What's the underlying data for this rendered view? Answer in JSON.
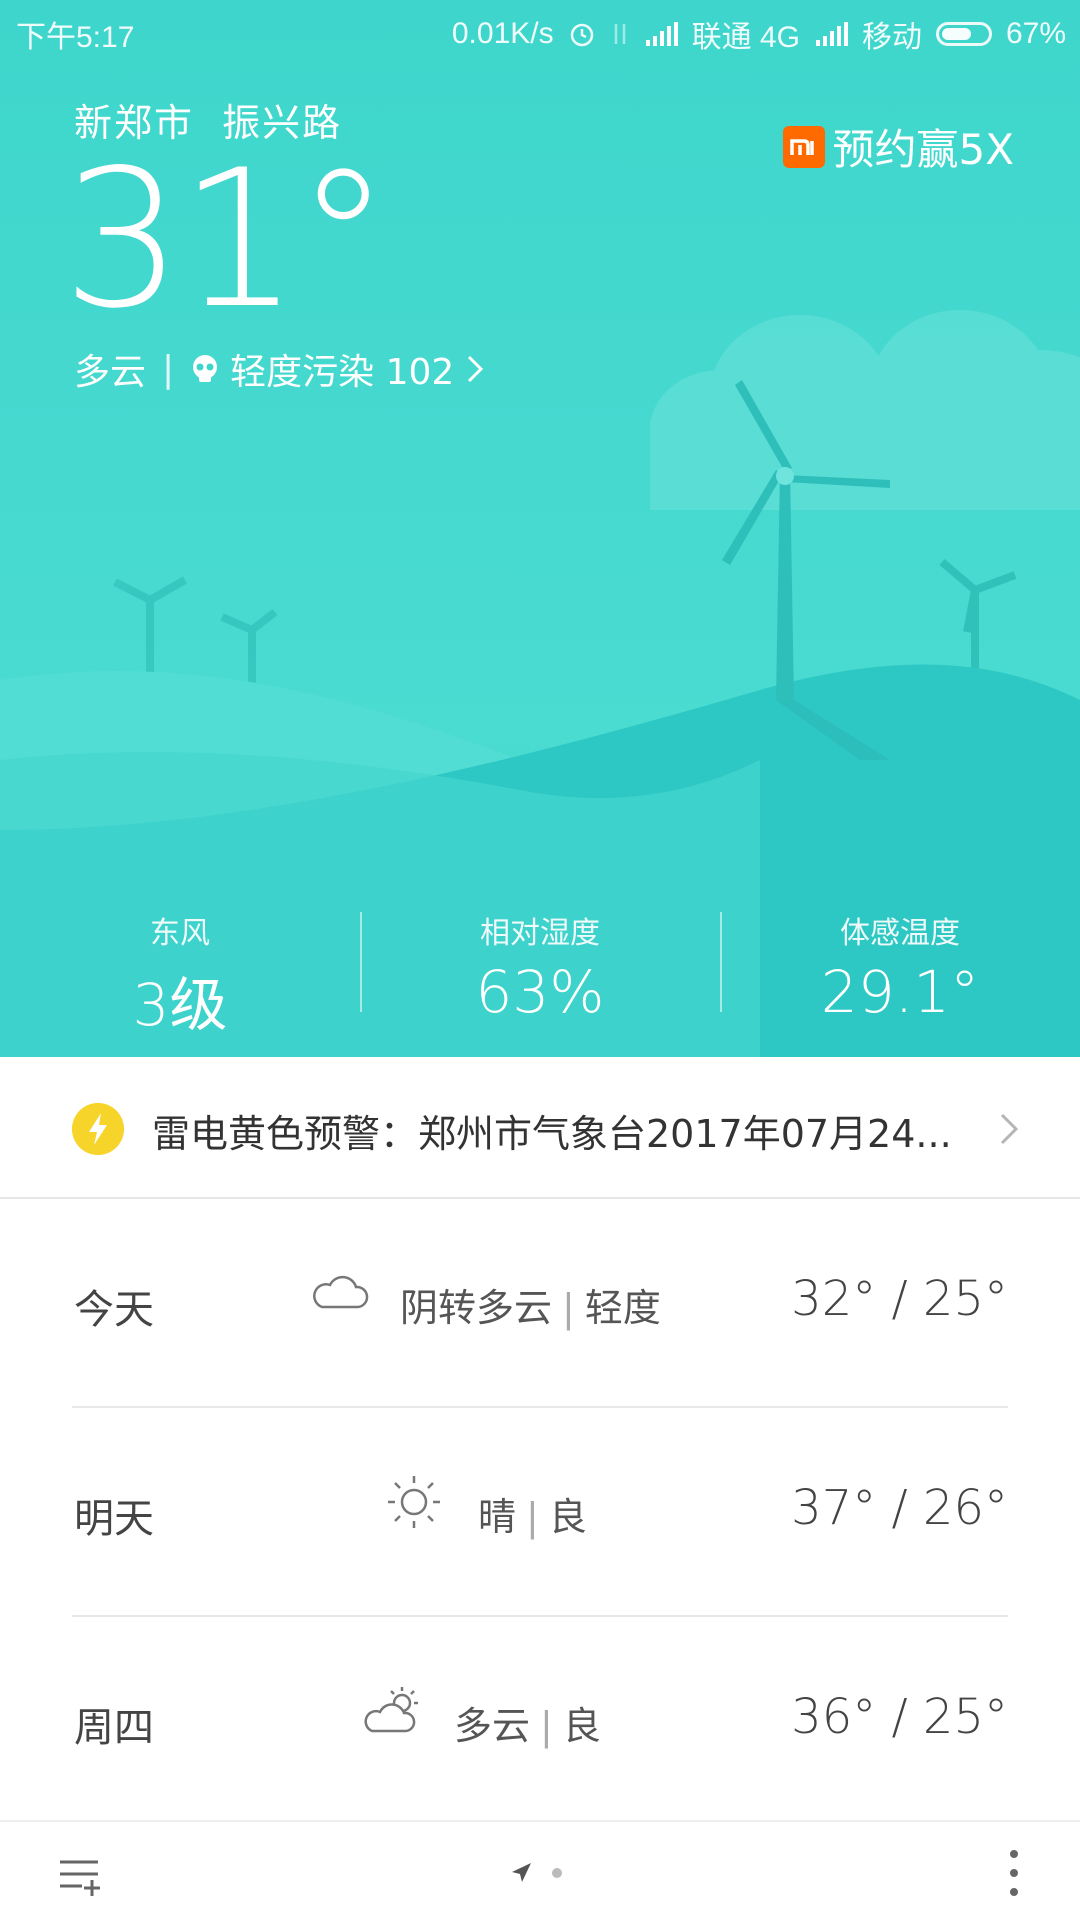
{
  "status_bar": {
    "time": "下午5:17",
    "network_speed": "0.01K/s",
    "carrier1": "联通 4G",
    "carrier2": "移动",
    "battery": "67%",
    "battery_level": 0.67
  },
  "header": {
    "location": "新郑市  振兴路",
    "ad_text": "预约赢5X",
    "ad_logo": "mi"
  },
  "current": {
    "temperature": "31°",
    "condition": "多云",
    "aqi_label": "轻度污染 102"
  },
  "metrics": [
    {
      "label": "东风",
      "value": "3级"
    },
    {
      "label": "相对湿度",
      "value": "63%"
    },
    {
      "label": "体感温度",
      "value": "29.1°"
    }
  ],
  "alert": {
    "text": "雷电黄色预警：郑州市气象台2017年07月24...",
    "icon": "lightning-icon",
    "color": "#f7d42a"
  },
  "forecast": [
    {
      "day": "今天",
      "icon": "cloud-icon",
      "weather": "阴转多云",
      "air": "轻度",
      "temps": "32° / 25°"
    },
    {
      "day": "明天",
      "icon": "sun-icon",
      "weather": "晴",
      "air": "良",
      "temps": "37° / 26°"
    },
    {
      "day": "周四",
      "icon": "partly-cloudy-icon",
      "weather": "多云",
      "air": "良",
      "temps": "36° / 25°"
    }
  ],
  "bottom_bar": {
    "menu_icon": "list-add-icon",
    "location_icon": "navigation-arrow-icon",
    "more_icon": "more-vertical-icon"
  },
  "colors": {
    "hero_bg": "#3ed6cc",
    "accent_orange": "#ff6a00"
  }
}
